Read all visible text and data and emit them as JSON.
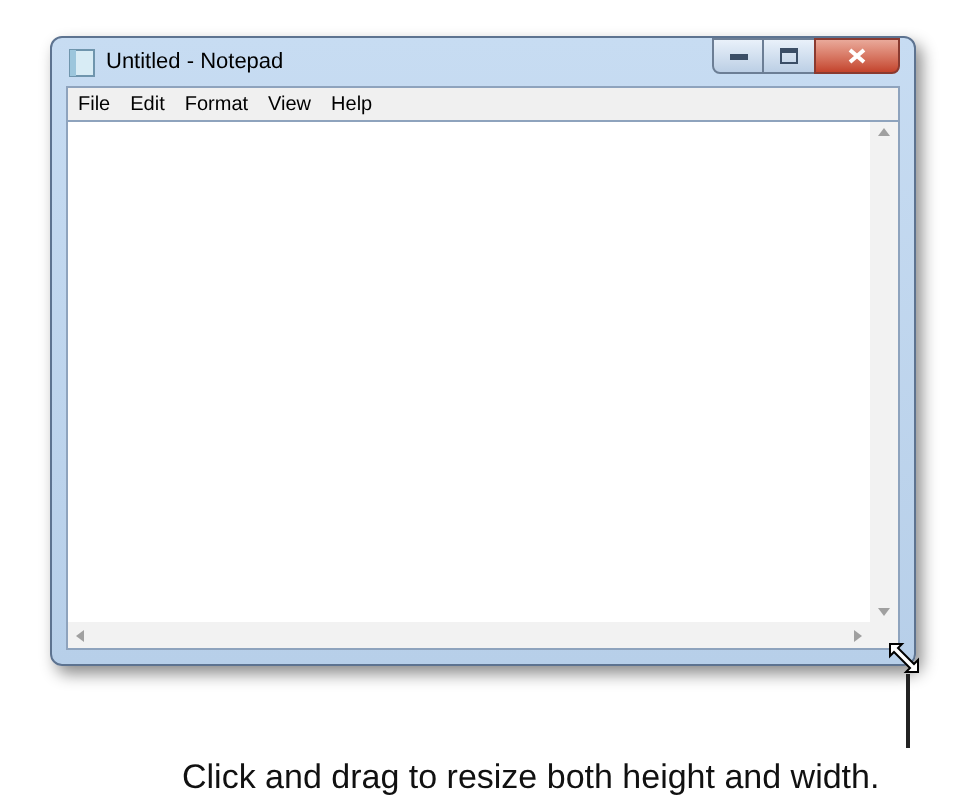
{
  "window": {
    "title": "Untitled - Notepad"
  },
  "menu": [
    {
      "label": "File"
    },
    {
      "label": "Edit"
    },
    {
      "label": "Format"
    },
    {
      "label": "View"
    },
    {
      "label": "Help"
    }
  ],
  "caption": "Click and drag to resize both height and width."
}
